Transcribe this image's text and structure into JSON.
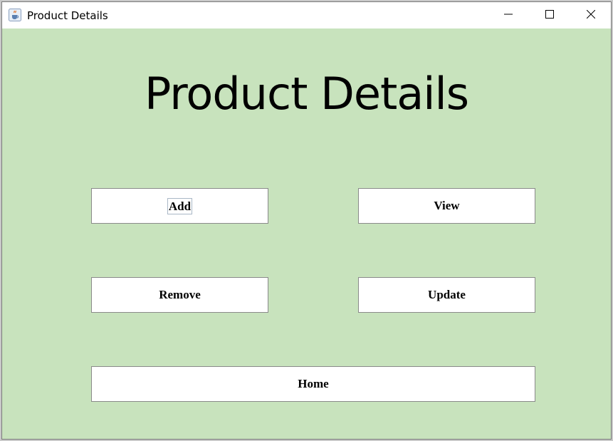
{
  "window": {
    "title": "Product Details",
    "icon": "java-cup-icon",
    "controls": [
      "minimize-icon",
      "maximize-icon",
      "close-icon"
    ]
  },
  "colors": {
    "background": "#c8e3bd",
    "button_bg": "#ffffff",
    "button_border": "#8a8a8a"
  },
  "main": {
    "heading": "Product Details",
    "buttons": {
      "add": "Add",
      "view": "View",
      "remove": "Remove",
      "update": "Update",
      "home": "Home"
    },
    "focused_button": "Add"
  }
}
